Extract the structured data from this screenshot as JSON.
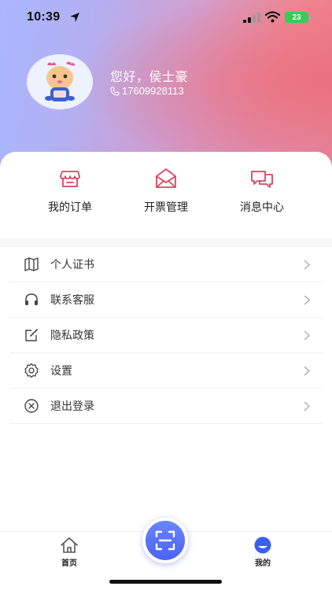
{
  "status_bar": {
    "time": "10:39",
    "battery": "23"
  },
  "profile": {
    "greeting": "您好，侯士豪",
    "phone": "17609928113"
  },
  "quick_actions": [
    {
      "label": "我的订单",
      "icon": "store-icon"
    },
    {
      "label": "开票管理",
      "icon": "envelope-icon"
    },
    {
      "label": "消息中心",
      "icon": "chat-icon"
    }
  ],
  "menu": [
    {
      "label": "个人证书",
      "icon": "map-icon"
    },
    {
      "label": "联系客服",
      "icon": "headphones-icon"
    },
    {
      "label": "隐私政策",
      "icon": "edit-icon"
    },
    {
      "label": "设置",
      "icon": "gear-icon"
    },
    {
      "label": "退出登录",
      "icon": "close-circle-icon"
    }
  ],
  "tabbar": {
    "home": "首页",
    "mine": "我的"
  },
  "colors": {
    "accent": "#e0435e",
    "tab_active": "#3a5ef0",
    "scan": "#5570f5"
  }
}
